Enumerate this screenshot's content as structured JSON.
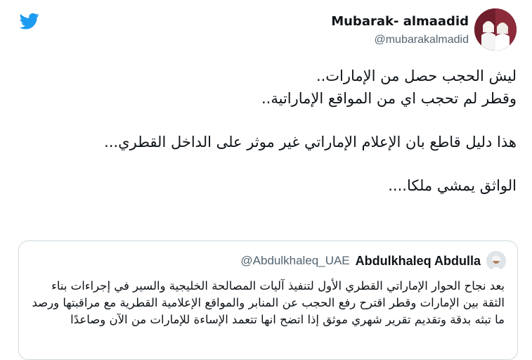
{
  "header": {
    "display_name": "Mubarak- almaadid",
    "handle": "@mubarakalmadid",
    "logo_icon": "twitter-bird-icon",
    "brand_color": "#1d9bf0"
  },
  "tweet": {
    "lines": [
      "ليش الحجب حصل من الإمارات..",
      "وقطر لم تحجب اي من المواقع الإماراتية..",
      "هذا دليل قاطع بان الإعلام الإماراتي غير موثر على الداخل القطري...",
      "الواثق يمشي ملكا...."
    ]
  },
  "quoted_tweet": {
    "display_name": "Abdulkhaleq Abdulla",
    "handle": "@Abdulkhaleq_UAE",
    "text": "بعد نجاح الحوار الإماراتي القطري الأول لتنفيذ آليات المصالحة الخليجية والسير في إجراءات بناء الثقة بين الإمارات وقطر اقترح رفع الحجب عن المنابر والمواقع الإعلامية القطرية مع مراقبتها ورصد ما تبثه بدقة وتقديم تقرير شهري موثق إذا اتضح انها تتعمد الإساءة للإمارات من الآن وصاعدًا"
  }
}
